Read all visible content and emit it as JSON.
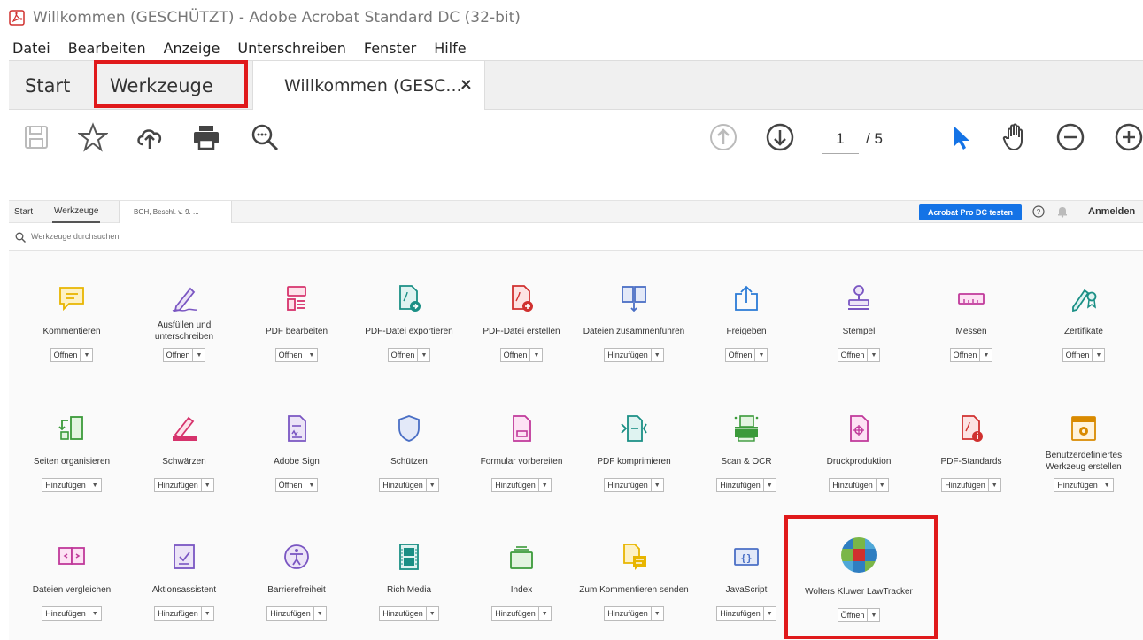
{
  "window": {
    "title": "Willkommen (GESCHÜTZT) - Adobe Acrobat Standard DC (32-bit)"
  },
  "menu": [
    "Datei",
    "Bearbeiten",
    "Anzeige",
    "Unterschreiben",
    "Fenster",
    "Hilfe"
  ],
  "tabs": {
    "start": "Start",
    "werkzeuge": "Werkzeuge",
    "doc": "Willkommen (GESC...",
    "close": "×"
  },
  "toolbar": {
    "page_current": "1",
    "page_total": "/ 5"
  },
  "inner": {
    "tabs": {
      "start": "Start",
      "werkzeuge": "Werkzeuge",
      "doc": "BGH, Beschl. v. 9. ..."
    },
    "try_pro": "Acrobat Pro DC testen",
    "signin": "Anmelden",
    "search_placeholder": "Werkzeuge durchsuchen"
  },
  "colors": {
    "accent_blue": "#1473e6",
    "highlight_red": "#e0191b",
    "tool_blue": "#4a7fd0",
    "pointer_blue": "#1473e6"
  },
  "tools": [
    {
      "name": "Kommentieren",
      "button": "Öffnen",
      "icon": "comment-icon"
    },
    {
      "name": "Ausfüllen und unterschreiben",
      "button": "Öffnen",
      "icon": "fill-sign-icon"
    },
    {
      "name": "PDF bearbeiten",
      "button": "Öffnen",
      "icon": "edit-pdf-icon"
    },
    {
      "name": "PDF-Datei exportieren",
      "button": "Öffnen",
      "icon": "export-pdf-icon"
    },
    {
      "name": "PDF-Datei erstellen",
      "button": "Öffnen",
      "icon": "create-pdf-icon"
    },
    {
      "name": "Dateien zusammenführen",
      "button": "Hinzufügen",
      "icon": "combine-files-icon"
    },
    {
      "name": "Freigeben",
      "button": "Öffnen",
      "icon": "share-icon"
    },
    {
      "name": "Stempel",
      "button": "Öffnen",
      "icon": "stamp-icon"
    },
    {
      "name": "Messen",
      "button": "Öffnen",
      "icon": "measure-icon"
    },
    {
      "name": "Zertifikate",
      "button": "Öffnen",
      "icon": "certificate-icon"
    },
    {
      "name": "Seiten organisieren",
      "button": "Hinzufügen",
      "icon": "organize-pages-icon"
    },
    {
      "name": "Schwärzen",
      "button": "Hinzufügen",
      "icon": "redact-icon"
    },
    {
      "name": "Adobe Sign",
      "button": "Öffnen",
      "icon": "adobe-sign-icon"
    },
    {
      "name": "Schützen",
      "button": "Hinzufügen",
      "icon": "protect-icon"
    },
    {
      "name": "Formular vorbereiten",
      "button": "Hinzufügen",
      "icon": "prepare-form-icon"
    },
    {
      "name": "PDF komprimieren",
      "button": "Hinzufügen",
      "icon": "compress-pdf-icon"
    },
    {
      "name": "Scan & OCR",
      "button": "Hinzufügen",
      "icon": "scan-ocr-icon"
    },
    {
      "name": "Druckproduktion",
      "button": "Hinzufügen",
      "icon": "print-production-icon"
    },
    {
      "name": "PDF-Standards",
      "button": "Hinzufügen",
      "icon": "pdf-standards-icon"
    },
    {
      "name": "Benutzerdefiniertes Werkzeug erstellen",
      "button": "Hinzufügen",
      "icon": "custom-tool-icon"
    },
    {
      "name": "Dateien vergleichen",
      "button": "Hinzufügen",
      "icon": "compare-files-icon"
    },
    {
      "name": "Aktionsassistent",
      "button": "Hinzufügen",
      "icon": "action-wizard-icon"
    },
    {
      "name": "Barrierefreiheit",
      "button": "Hinzufügen",
      "icon": "accessibility-icon"
    },
    {
      "name": "Rich Media",
      "button": "Hinzufügen",
      "icon": "rich-media-icon"
    },
    {
      "name": "Index",
      "button": "Hinzufügen",
      "icon": "index-icon"
    },
    {
      "name": "Zum Kommentieren senden",
      "button": "Hinzufügen",
      "icon": "send-comment-icon"
    },
    {
      "name": "JavaScript",
      "button": "Hinzufügen",
      "icon": "javascript-icon"
    },
    {
      "name": "Wolters Kluwer LawTracker",
      "button": "Öffnen",
      "icon": "lawtracker-icon"
    }
  ]
}
